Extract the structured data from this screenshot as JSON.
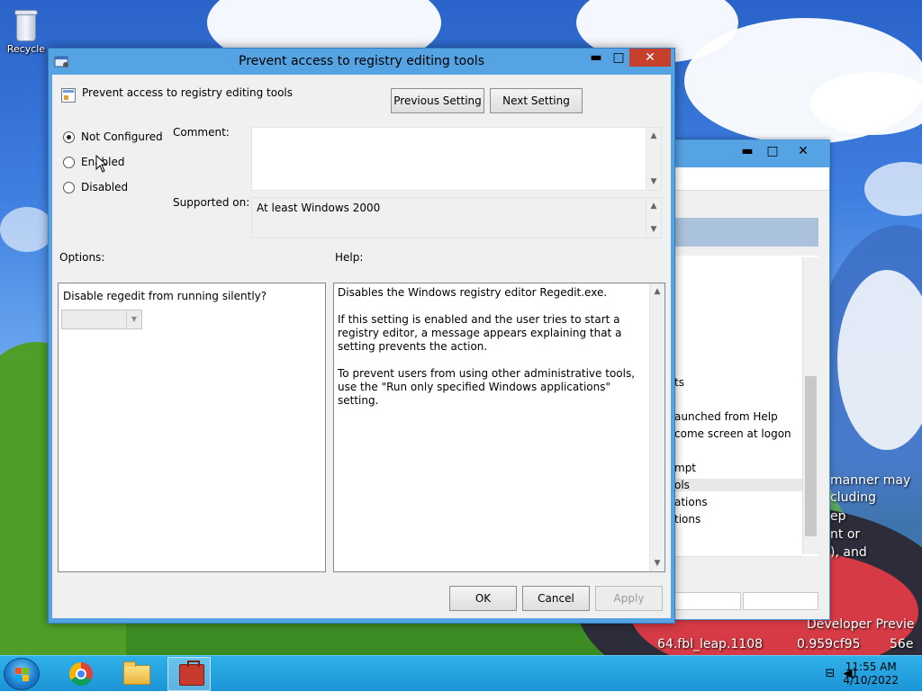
{
  "desktop": {
    "recycle_label": "Recycle"
  },
  "background_window": {
    "minimize": "▬",
    "maximize": "□",
    "close": "✕",
    "list_items": [
      "ts",
      "aunched from Help",
      "come screen at logon",
      "mpt",
      "ols",
      "ations",
      "tions"
    ],
    "selected_index": 4
  },
  "wallpaper_text": {
    "lines": [
      "manner may",
      "cluding",
      "ep",
      "nt or",
      "), and",
      "Developer Previe",
      "64.fbl_leap.1108",
      "0.959cf95",
      "56e"
    ]
  },
  "dialog": {
    "title": "Prevent access to registry editing tools",
    "minimize": "▬",
    "maximize": "□",
    "close": "✕",
    "setting_name": "Prevent access to registry editing tools",
    "previous_setting": "Previous Setting",
    "next_setting": "Next Setting",
    "radio_options": {
      "not_configured": "Not Configured",
      "enabled": "Enabled",
      "disabled": "Disabled"
    },
    "selected_option": "not_configured",
    "comment_label": "Comment:",
    "comment_value": "",
    "supported_on_label": "Supported on:",
    "supported_on_value": "At least Windows 2000",
    "options_label": "Options:",
    "help_label": "Help:",
    "option_prompt": "Disable regedit from running silently?",
    "option_combo_value": "",
    "help_text": "Disables the Windows registry editor Regedit.exe.\n\nIf this setting is enabled and the user tries to start a registry editor, a message appears explaining that a setting prevents the action.\n\nTo prevent users from using other administrative tools, use the \"Run only specified Windows applications\" setting.",
    "ok": "OK",
    "cancel": "Cancel",
    "apply": "Apply"
  },
  "taskbar": {
    "time": "11:55 AM",
    "date": "4/10/2022",
    "icons": [
      "start-icon",
      "chrome-icon",
      "file-explorer-icon",
      "registry-tool-icon"
    ]
  }
}
